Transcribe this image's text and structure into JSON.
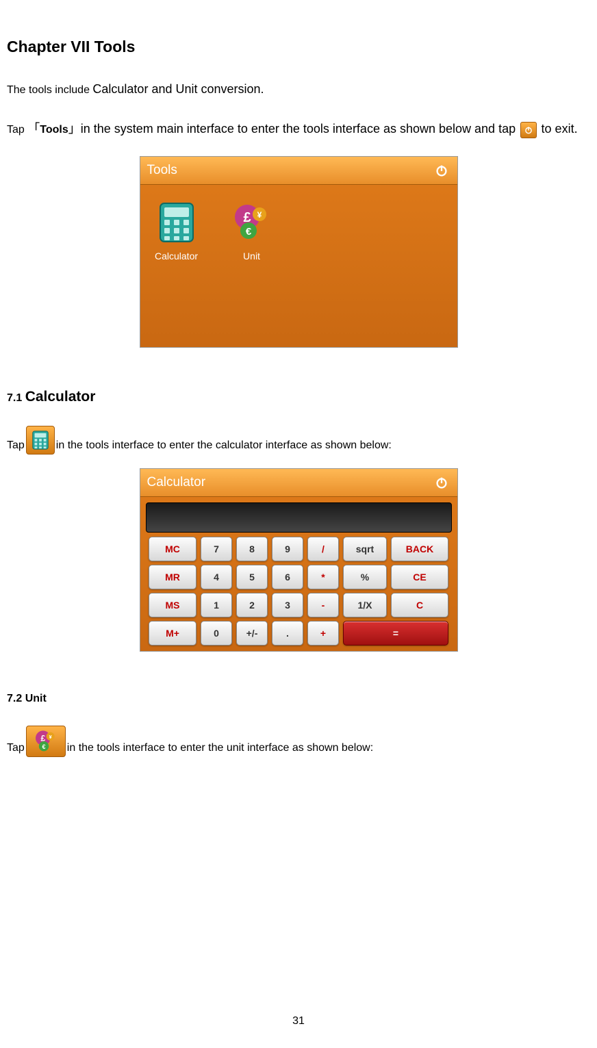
{
  "doc": {
    "chapter_title": "Chapter VII Tools",
    "intro_1a": "The tools include ",
    "intro_1b": "Calculator and Unit conversion.",
    "intro_2a": "Tap ",
    "intro_2b": "「",
    "intro_2c": "Tools",
    "intro_2d": "」",
    "intro_2e": "in the system main interface to enter the tools interface as shown below and tap ",
    "intro_2f": " to exit.",
    "sec71_num": "7.1 ",
    "sec71_title": "Calculator",
    "sec71_para_a": "Tap",
    "sec71_para_b": "in the tools interface to enter the calculator interface as shown below:",
    "sec72": "7.2 Unit",
    "sec72_para_a": "Tap",
    "sec72_para_b": "in the tools interface to enter the unit interface as shown below:",
    "page_number": "31"
  },
  "tools_shot": {
    "title": "Tools",
    "tiles": [
      {
        "label": "Calculator"
      },
      {
        "label": "Unit"
      }
    ]
  },
  "calc_shot": {
    "title": "Calculator",
    "rows": [
      [
        "MC",
        "7",
        "8",
        "9",
        "/",
        "sqrt",
        "BACK"
      ],
      [
        "MR",
        "4",
        "5",
        "6",
        "*",
        "%",
        "CE"
      ],
      [
        "MS",
        "1",
        "2",
        "3",
        "-",
        "1/X",
        "C"
      ],
      [
        "M+",
        "0",
        "+/-",
        ".",
        "+",
        "="
      ]
    ]
  }
}
